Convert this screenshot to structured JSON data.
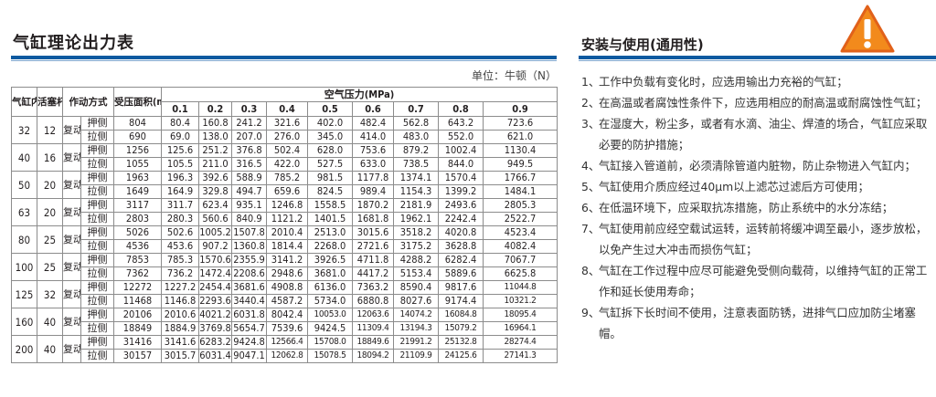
{
  "left_title": "气缸理论出力表",
  "unit": "单位：牛顿（N）",
  "table": {
    "col_bore": "气缸内径",
    "col_rod": "活塞杆外径",
    "col_action": "作动方式",
    "col_area": "受压面积(mm²)",
    "col_pressure": "空气压力(MPa)",
    "pressures": [
      "0.1",
      "0.2",
      "0.3",
      "0.4",
      "0.5",
      "0.6",
      "0.7",
      "0.8",
      "0.9"
    ],
    "action_type": "复动",
    "push_label": "押侧",
    "pull_label": "拉侧",
    "rows": [
      {
        "bore": "32",
        "rod": "12",
        "push": [
          "804",
          "80.4",
          "160.8",
          "241.2",
          "321.6",
          "402.0",
          "482.4",
          "562.8",
          "643.2",
          "723.6"
        ],
        "pull": [
          "690",
          "69.0",
          "138.0",
          "207.0",
          "276.0",
          "345.0",
          "414.0",
          "483.0",
          "552.0",
          "621.0"
        ]
      },
      {
        "bore": "40",
        "rod": "16",
        "push": [
          "1256",
          "125.6",
          "251.2",
          "376.8",
          "502.4",
          "628.0",
          "753.6",
          "879.2",
          "1002.4",
          "1130.4"
        ],
        "pull": [
          "1055",
          "105.5",
          "211.0",
          "316.5",
          "422.0",
          "527.5",
          "633.0",
          "738.5",
          "844.0",
          "949.5"
        ]
      },
      {
        "bore": "50",
        "rod": "20",
        "push": [
          "1963",
          "196.3",
          "392.6",
          "588.9",
          "785.2",
          "981.5",
          "1177.8",
          "1374.1",
          "1570.4",
          "1766.7"
        ],
        "pull": [
          "1649",
          "164.9",
          "329.8",
          "494.7",
          "659.6",
          "824.5",
          "989.4",
          "1154.3",
          "1399.2",
          "1484.1"
        ]
      },
      {
        "bore": "63",
        "rod": "20",
        "push": [
          "3117",
          "311.7",
          "623.4",
          "935.1",
          "1246.8",
          "1558.5",
          "1870.2",
          "2181.9",
          "2493.6",
          "2805.3"
        ],
        "pull": [
          "2803",
          "280.3",
          "560.6",
          "840.9",
          "1121.2",
          "1401.5",
          "1681.8",
          "1962.1",
          "2242.4",
          "2522.7"
        ]
      },
      {
        "bore": "80",
        "rod": "25",
        "push": [
          "5026",
          "502.6",
          "1005.2",
          "1507.8",
          "2010.4",
          "2513.0",
          "3015.6",
          "3518.2",
          "4020.8",
          "4523.4"
        ],
        "pull": [
          "4536",
          "453.6",
          "907.2",
          "1360.8",
          "1814.4",
          "2268.0",
          "2721.6",
          "3175.2",
          "3628.8",
          "4082.4"
        ]
      },
      {
        "bore": "100",
        "rod": "25",
        "push": [
          "7853",
          "785.3",
          "1570.6",
          "2355.9",
          "3141.2",
          "3926.5",
          "4711.8",
          "4288.2",
          "6282.4",
          "7067.7"
        ],
        "pull": [
          "7362",
          "736.2",
          "1472.4",
          "2208.6",
          "2948.6",
          "3681.0",
          "4417.2",
          "5153.4",
          "5889.6",
          "6625.8"
        ]
      },
      {
        "bore": "125",
        "rod": "32",
        "push": [
          "12272",
          "1227.2",
          "2454.4",
          "3681.6",
          "4908.8",
          "6136.0",
          "7363.2",
          "8590.4",
          "9817.6",
          "11044.8"
        ],
        "pull": [
          "11468",
          "1146.8",
          "2293.6",
          "3440.4",
          "4587.2",
          "5734.0",
          "6880.8",
          "8027.6",
          "9174.4",
          "10321.2"
        ]
      },
      {
        "bore": "160",
        "rod": "40",
        "push": [
          "20106",
          "2010.6",
          "4021.2",
          "6031.8",
          "8042.4",
          "10053.0",
          "12063.6",
          "14074.2",
          "16084.8",
          "18095.4"
        ],
        "pull": [
          "18849",
          "1884.9",
          "3769.8",
          "5654.7",
          "7539.6",
          "9424.5",
          "11309.4",
          "13194.3",
          "15079.2",
          "16964.1"
        ]
      },
      {
        "bore": "200",
        "rod": "40",
        "push": [
          "31416",
          "3141.6",
          "6283.2",
          "9424.8",
          "12566.4",
          "15708.0",
          "18849.6",
          "21991.2",
          "25132.8",
          "28274.4"
        ],
        "pull": [
          "30157",
          "3015.7",
          "6031.4",
          "9047.1",
          "12062.8",
          "15078.5",
          "18094.2",
          "21109.9",
          "24125.6",
          "27141.3"
        ]
      }
    ]
  },
  "right_title": "安装与使用(通用性)",
  "warning_icon": "exclamation-triangle-icon",
  "warning_colors": {
    "fill": "#f28a1c",
    "border": "#e1611a",
    "mark": "#ffffff"
  },
  "accent_color": "#0c5aa0",
  "notes": [
    {
      "num": "1、",
      "text": "工作中负载有变化时，应选用输出力充裕的气缸；"
    },
    {
      "num": "2、",
      "text": "在高温或者腐蚀性条件下，应选用相应的耐高温或耐腐蚀性气缸；"
    },
    {
      "num": "3、",
      "text": "在湿度大，粉尘多，或者有水滴、油尘、焊渣的场合，气缸应采取必要的防护措施；"
    },
    {
      "num": "4、",
      "text": "气缸接入管道前，必须清除管道内脏物，防止杂物进入气缸内；"
    },
    {
      "num": "5、",
      "text": "气缸使用介质应经过40μm以上滤芯过滤后方可使用；"
    },
    {
      "num": "6、",
      "text": "在低温环境下，应采取抗冻措施，防止系统中的水分冻结；"
    },
    {
      "num": "7、",
      "text": "气缸使用前应经空载试运转，运转前将缓冲调至最小，逐步放松，以免产生过大冲击而损伤气缸；"
    },
    {
      "num": "8、",
      "text": "气缸在工作过程中应尽可能避免受侧向载荷，以维持气缸的正常工作和延长使用寿命；"
    },
    {
      "num": "9、",
      "text": "气缸拆下长时间不使用，注意表面防锈，进排气口应加防尘堵塞帽。"
    }
  ]
}
